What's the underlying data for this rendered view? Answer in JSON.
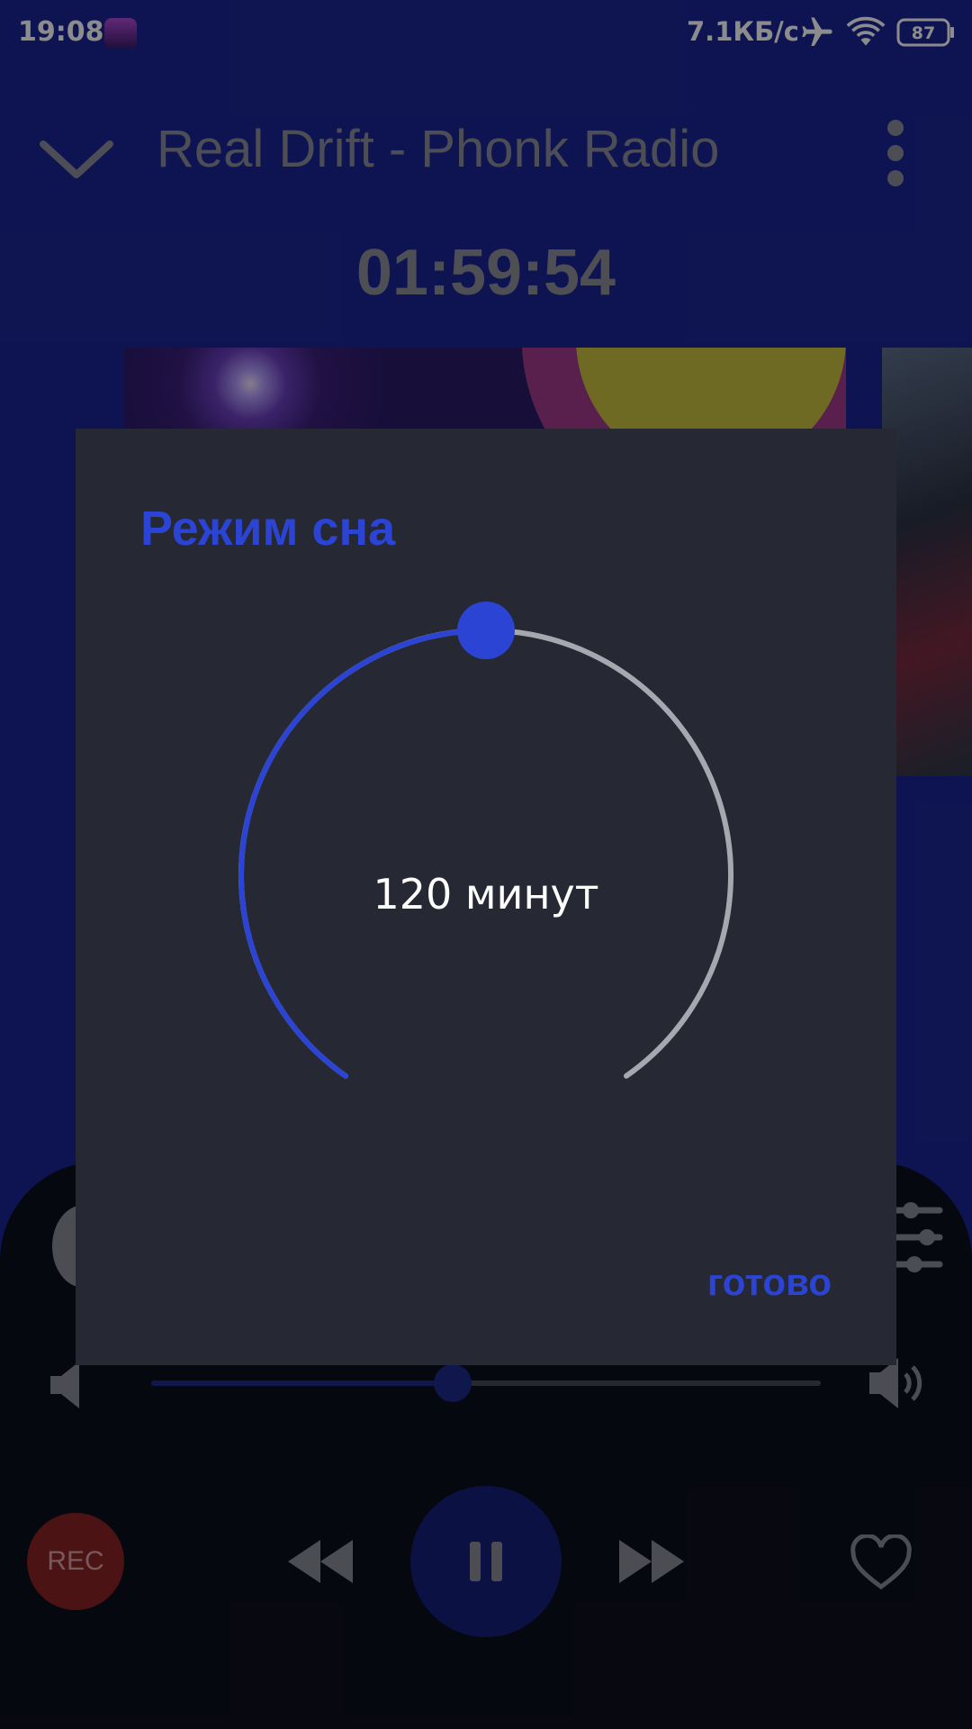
{
  "status_bar": {
    "time": "19:08",
    "network_speed": "7.1КБ/с",
    "battery_level": "87",
    "icons": [
      "app-icon",
      "airplane-icon",
      "wifi-icon",
      "battery-icon"
    ]
  },
  "player": {
    "station_title": "Real Drift - Phonk Radio",
    "timer": "01:59:54",
    "volume_level": 0.45,
    "rec_label": "REC",
    "icons": [
      "chevron-down-icon",
      "more-vert-icon",
      "equalizer-icon",
      "volume-low-icon",
      "volume-high-icon",
      "rewind-icon",
      "pause-icon",
      "forward-icon",
      "heart-icon"
    ]
  },
  "dialog": {
    "title": "Режим сна",
    "value_text": "120 минут",
    "dial_fraction": 0.5,
    "done_label": "готово"
  },
  "colors": {
    "accent": "#2c44d4",
    "app_background": "#1a2694",
    "dialog_background": "#262833",
    "dial_track": "#a6a8b0",
    "rec": "#8a2326"
  }
}
